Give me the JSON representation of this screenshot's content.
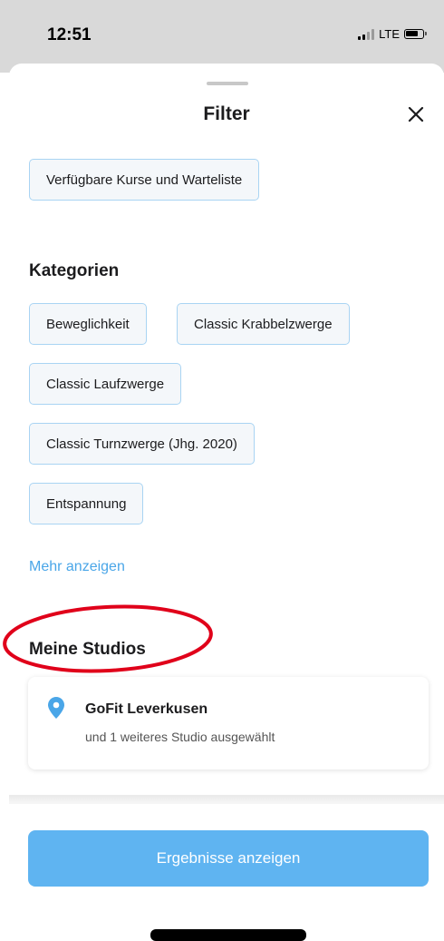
{
  "status_bar": {
    "time": "12:51",
    "network": "LTE"
  },
  "sheet": {
    "title": "Filter"
  },
  "availability": {
    "chip_label": "Verfügbare Kurse und Warteliste"
  },
  "categories": {
    "heading": "Kategorien",
    "chips": [
      "Beweglichkeit",
      "Classic Krabbelzwerge",
      "Classic Laufzwerge",
      "Classic Turnzwerge (Jhg. 2020)",
      "Entspannung"
    ],
    "more_link": "Mehr anzeigen"
  },
  "studios": {
    "heading": "Meine Studios",
    "studio_name": "GoFit Leverkusen",
    "studio_subtitle": "und 1 weiteres Studio ausgewählt"
  },
  "footer": {
    "results_button": "Ergebnisse anzeigen"
  },
  "colors": {
    "accent": "#5fb4f1",
    "link": "#4aa6e8",
    "chip_border": "#a9d4f3",
    "highlight_ellipse": "#e0001a"
  },
  "icons": {
    "close": "close-icon",
    "location": "location-pin-icon"
  }
}
